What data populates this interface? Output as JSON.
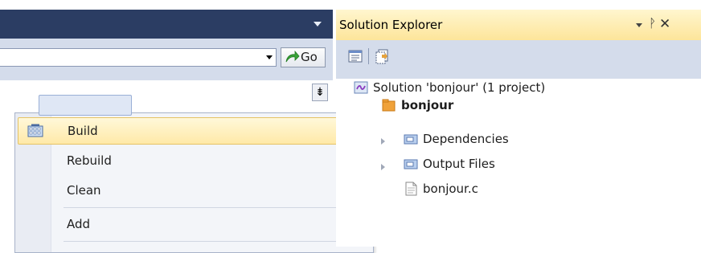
{
  "context_menu": {
    "items": [
      {
        "label": "Build",
        "highlighted": true,
        "icon": "build-icon"
      },
      {
        "label": "Rebuild"
      },
      {
        "label": "Clean"
      },
      {
        "label": "Add",
        "has_submenu": true
      }
    ]
  },
  "navigation": {
    "go_label": "Go"
  },
  "solution_explorer": {
    "title": "Solution Explorer",
    "pin_glyph": "ᚹ",
    "close_glyph": "✕",
    "tree": {
      "solution": "Solution 'bonjour' (1 project)",
      "project": "bonjour",
      "folders": [
        "Dependencies",
        "Output Files"
      ],
      "file": "bonjour.c"
    }
  },
  "colors": {
    "titlebar": "#2b3d63",
    "toolbar": "#d4dceb",
    "menu_highlight": "#ffe9a8",
    "selection": "#dfe7f5"
  }
}
